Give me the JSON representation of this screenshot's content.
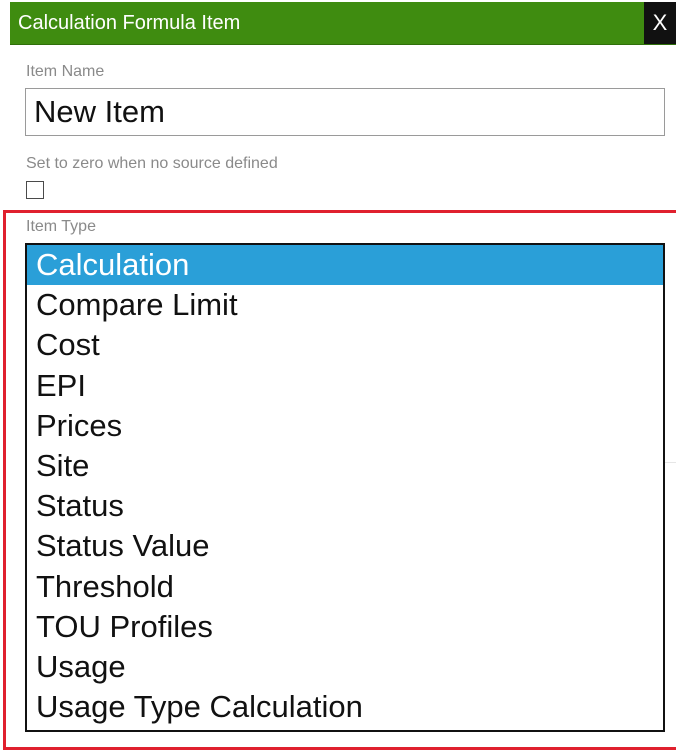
{
  "dialog": {
    "title": "Calculation Formula Item",
    "close_label": "X"
  },
  "form": {
    "item_name": {
      "label": "Item Name",
      "value": "New Item"
    },
    "zero_when_no_source": {
      "label": "Set to zero when no source defined",
      "checked": false
    },
    "item_type": {
      "label": "Item Type",
      "selected": "Calculation",
      "options": [
        "Calculation",
        "Compare Limit",
        "Cost",
        "EPI",
        "Prices",
        "Site",
        "Status",
        "Status Value",
        "Threshold",
        "TOU Profiles",
        "Usage",
        "Usage Type Calculation"
      ]
    }
  },
  "colors": {
    "titlebar": "#3f8c10",
    "close_button": "#111111",
    "selection": "#2a9fd8",
    "highlight_frame": "#e0202e"
  }
}
